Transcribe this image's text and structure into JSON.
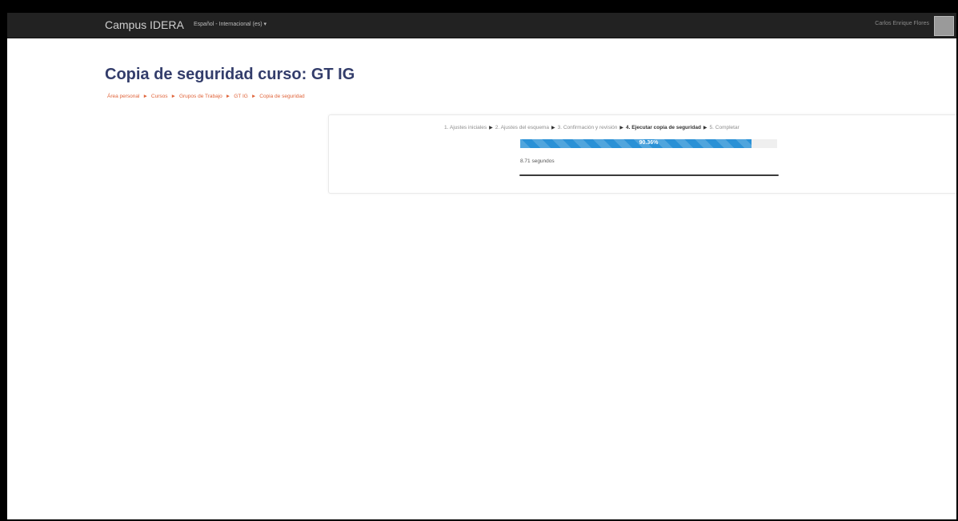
{
  "navbar": {
    "brand": "Campus IDERA",
    "language": "Español - Internacional (es) ▾",
    "user_name": "Carlos Enrique Flores"
  },
  "page": {
    "title": "Copia de seguridad curso: GT IG"
  },
  "breadcrumb": {
    "items": [
      "Área personal",
      "Cursos",
      "Grupos de Trabajo",
      "GT IG",
      "Copia de seguridad"
    ],
    "separator": "►"
  },
  "backup": {
    "steps": [
      {
        "label": "1. Ajustes iniciales",
        "current": false
      },
      {
        "label": "2. Ajustes del esquema",
        "current": false
      },
      {
        "label": "3. Confirmación y revisión",
        "current": false
      },
      {
        "label": "4. Ejecutar copia de seguridad",
        "current": true
      },
      {
        "label": "5. Completar",
        "current": false
      }
    ],
    "step_arrow": "▶",
    "progress_percent": 90,
    "progress_label": "90.36%",
    "elapsed": "8.71 segundos"
  },
  "colors": {
    "navbar_bg": "#222222",
    "title": "#333d6b",
    "breadcrumb_link": "#e0643a",
    "progress_fill": "#2a91d6"
  }
}
